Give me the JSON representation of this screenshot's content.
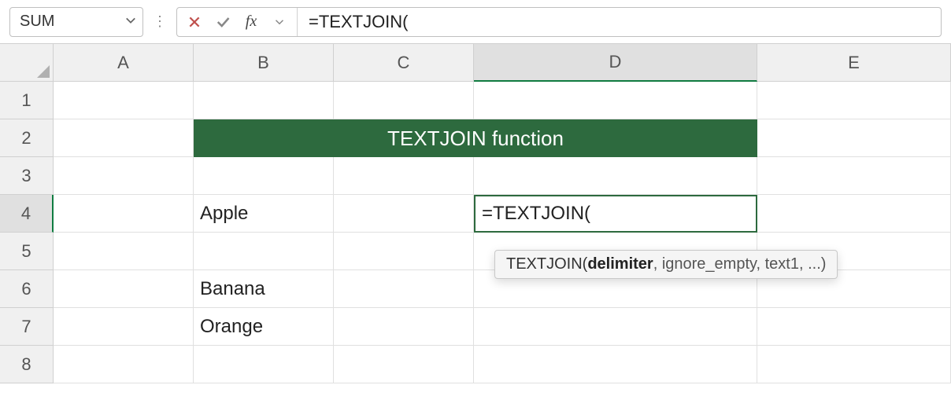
{
  "formula_bar": {
    "name_box": "SUM",
    "formula": "=TEXTJOIN("
  },
  "columns": [
    "A",
    "B",
    "C",
    "D",
    "E"
  ],
  "rows": [
    "1",
    "2",
    "3",
    "4",
    "5",
    "6",
    "7",
    "8"
  ],
  "active_column_index": 3,
  "active_row_index": 3,
  "cells": {
    "title": "TEXTJOIN function",
    "B4": "Apple",
    "B6": "Banana",
    "B7": "Orange",
    "D4": "=TEXTJOIN("
  },
  "tooltip": {
    "fn": "TEXTJOIN(",
    "arg_active": "delimiter",
    "rest": ", ignore_empty, text1, ...)"
  }
}
